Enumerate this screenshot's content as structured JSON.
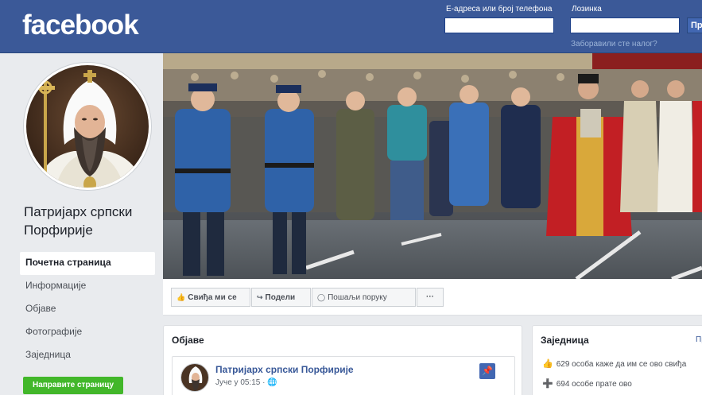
{
  "header": {
    "logo": "facebook",
    "email_label": "Е-адреса или број телефона",
    "password_label": "Лозинка",
    "forgot_link": "Заборавили сте налог?",
    "login_button": "Пр"
  },
  "page": {
    "name": "Патријарх српски Порфирије"
  },
  "nav": {
    "items": [
      {
        "label": "Почетна страница"
      },
      {
        "label": "Информације"
      },
      {
        "label": "Објаве"
      },
      {
        "label": "Фотографије"
      },
      {
        "label": "Заједница"
      }
    ],
    "create_page_button": "Направите страницу"
  },
  "actions": {
    "like": "Свиђа ми се",
    "share": "Подели",
    "message": "Пошаљи поруку",
    "more": "···"
  },
  "posts_panel": {
    "title": "Објаве",
    "post": {
      "author": "Патријарх српски Порфирије",
      "time": "Јуче у 05:15 ·"
    }
  },
  "community_panel": {
    "title": "Заједница",
    "see_all": "Пр",
    "likes": "629 особа каже да им се ово свиђа",
    "follows": "694 особе прате ово"
  },
  "colors": {
    "brand": "#3b5998",
    "link": "#385898",
    "create_button": "#42b72a"
  }
}
